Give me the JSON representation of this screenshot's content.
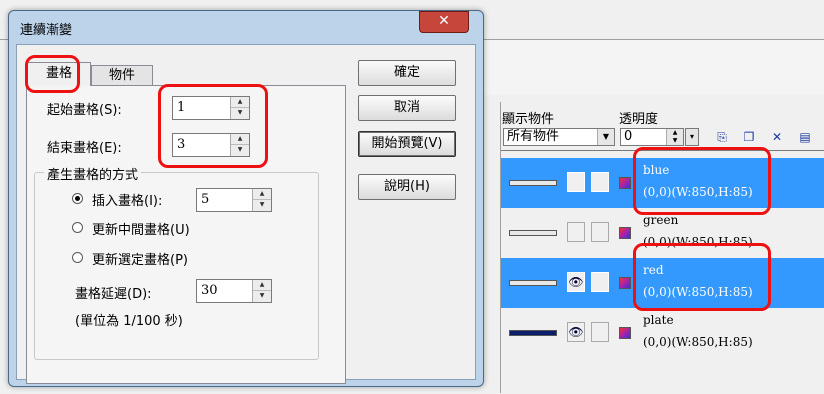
{
  "dialog": {
    "title": "連續漸變",
    "close_glyph": "✕",
    "tabs": [
      {
        "label": "畫格",
        "active": true
      },
      {
        "label": "物件",
        "active": false
      }
    ],
    "start_frame": {
      "label": "起始畫格(S):",
      "value": "1"
    },
    "end_frame": {
      "label": "結束畫格(E):",
      "value": "3"
    },
    "group": {
      "title": "產生畫格的方式",
      "options": [
        {
          "label": "插入畫格(I):",
          "selected": true,
          "value": "5"
        },
        {
          "label": "更新中間畫格(U)",
          "selected": false
        },
        {
          "label": "更新選定畫格(P)",
          "selected": false
        }
      ],
      "delay": {
        "label": "畫格延遲(D):",
        "value": "30"
      },
      "unit_note": "(單位為 1/100 秒)"
    },
    "buttons": {
      "ok": "確定",
      "cancel": "取消",
      "preview": "開始預覽(V)",
      "help": "說明(H)"
    }
  },
  "panel": {
    "show_label": "顯示物件",
    "show_value": "所有物件",
    "opacity_label": "透明度",
    "opacity_value": "0",
    "layers": [
      {
        "name": "blue",
        "dims": "(0,0)(W:850,H:85)",
        "selected": true,
        "visible": false,
        "thumb_color": "#4a4aff"
      },
      {
        "name": "green",
        "dims": "(0,0)(W:850,H:85)",
        "selected": false,
        "visible": false,
        "thumb_color": "#3a9a3a"
      },
      {
        "name": "red",
        "dims": "(0,0)(W:850,H:85)",
        "selected": true,
        "visible": true,
        "thumb_color": "#e04040"
      },
      {
        "name": "plate",
        "dims": "(0,0)(W:850,H:85)",
        "selected": false,
        "visible": true,
        "thumb_color": "#0b1e6b"
      }
    ]
  },
  "colors": {
    "highlight": "#e11111",
    "selection": "#3399ff",
    "title_bar": "#bcd3ea"
  }
}
